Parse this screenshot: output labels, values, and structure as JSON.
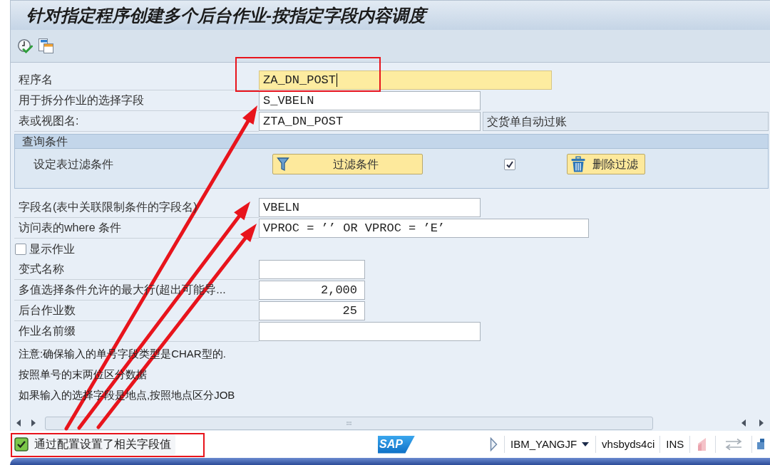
{
  "window": {
    "title": "针对指定程序创建多个后台作业-按指定字段内容调度"
  },
  "top_fields": [
    {
      "label": "程序名",
      "value": "ZA_DN_POST",
      "focused": true
    },
    {
      "label": "用于拆分作业的选择字段",
      "value": "S_VBELN",
      "focused": false
    },
    {
      "label": "表或视图名:",
      "value": "ZTA_DN_POST",
      "description": "交货单自动过账",
      "focused": false
    }
  ],
  "query": {
    "title": "查询条件",
    "label": "设定表过滤条件",
    "filter_button": "过滤条件",
    "checked": true,
    "delete_button": "删除过滤"
  },
  "lower_fields": [
    {
      "label": "字段名(表中关联限制条件的字段名)",
      "value": "VBELN"
    },
    {
      "label": "访问表的where 条件",
      "value": "VPROC = ’’ OR VPROC = ’E’"
    }
  ],
  "show_jobs": {
    "label": "显示作业",
    "checked": false
  },
  "job_fields": [
    {
      "label": "变式名称",
      "kind": "text"
    },
    {
      "label": "多值选择条件允许的最大行(超出可能导...",
      "value": "2,000",
      "kind": "number"
    },
    {
      "label": "后台作业数",
      "value": "25",
      "kind": "number"
    },
    {
      "label": "作业名前缀",
      "kind": "text"
    }
  ],
  "notes": [
    "注意:确保输入的单号字段类型是CHAR型的.",
    "按照单号的末两位区分数据",
    "如果输入的选择字段是地点,按照地点区分JOB"
  ],
  "status_bar": {
    "message": "通过配置设置了相关字段值",
    "logo": "SAP",
    "user": "IBM_YANGJF",
    "server": "vhsbyds4ci",
    "mode": "INS"
  }
}
